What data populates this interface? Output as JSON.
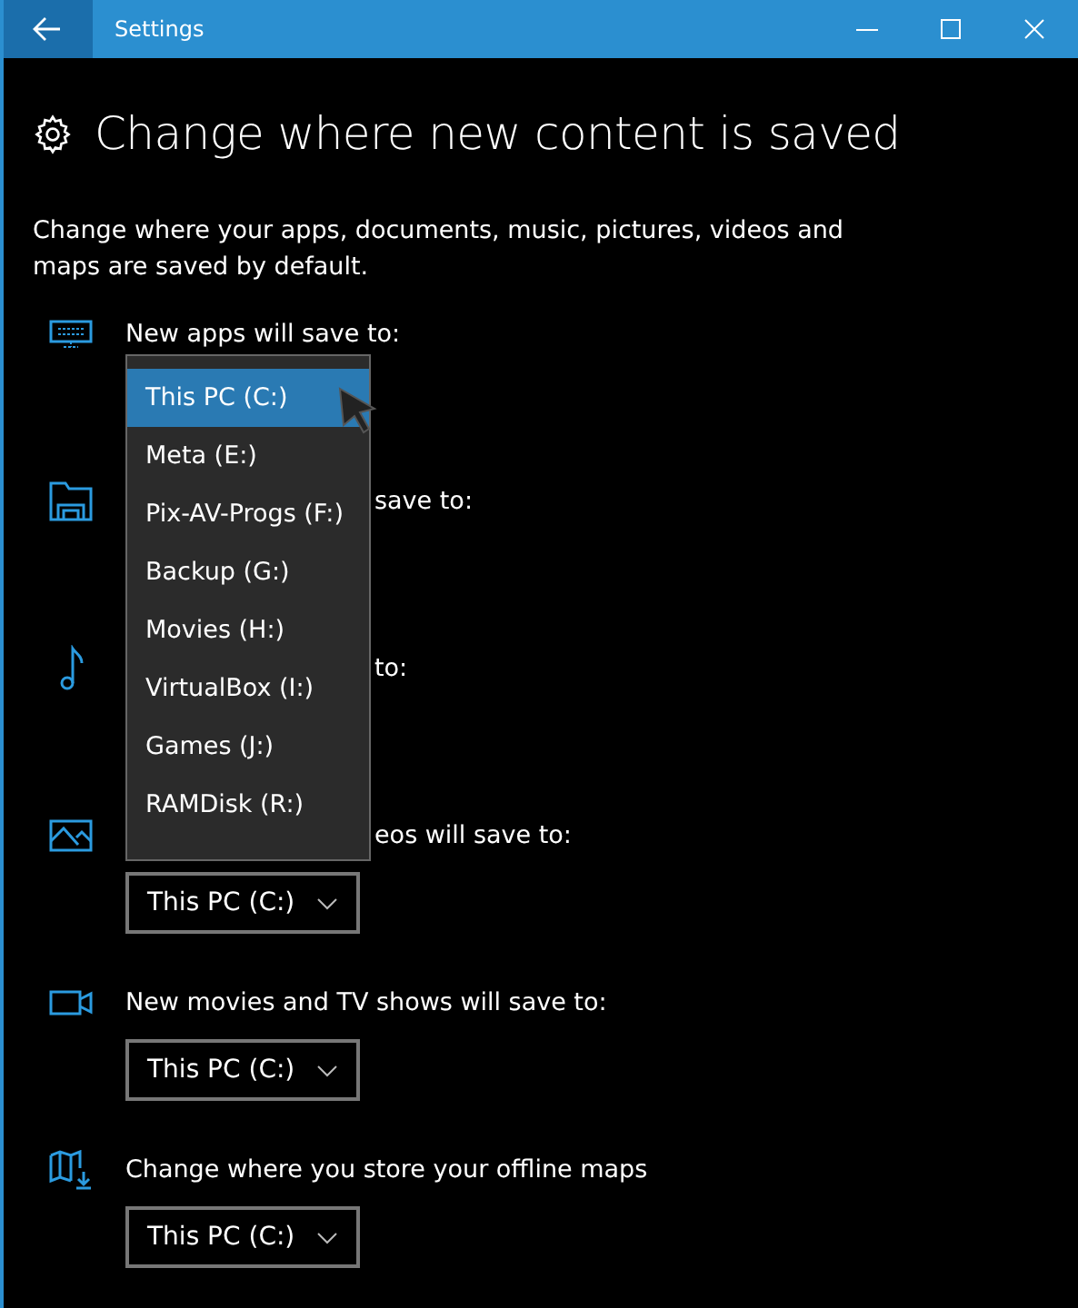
{
  "window": {
    "title": "Settings"
  },
  "heading": "Change where new content is saved",
  "description": "Change where your apps, documents, music, pictures, videos and maps are saved by default.",
  "sections": [
    {
      "kind": "monitor",
      "label": "New apps will save to:"
    },
    {
      "kind": "folder",
      "label": "save to:",
      "covered": true
    },
    {
      "kind": "music",
      "label": "to:",
      "covered": true
    },
    {
      "kind": "image",
      "label": "eos will save to:",
      "covered": true
    },
    {
      "kind": "camera",
      "label": "New movies and TV shows will save to:",
      "dropdown": "This PC (C:)"
    },
    {
      "kind": "map",
      "label": "Change where you store your offline maps",
      "dropdown": "This PC (C:)"
    }
  ],
  "menu": [
    {
      "label": "This PC (C:)",
      "selected": true
    },
    {
      "label": "Meta (E:)",
      "selected": false
    },
    {
      "label": "Pix-AV-Progs (F:)",
      "selected": false
    },
    {
      "label": "Backup (G:)",
      "selected": false
    },
    {
      "label": "Movies (H:)",
      "selected": false
    },
    {
      "label": "VirtualBox (I:)",
      "selected": false
    },
    {
      "label": "Games (J:)",
      "selected": false
    },
    {
      "label": "RAMDisk (R:)",
      "selected": false
    }
  ],
  "photos_dropdown": "This PC (C:)"
}
